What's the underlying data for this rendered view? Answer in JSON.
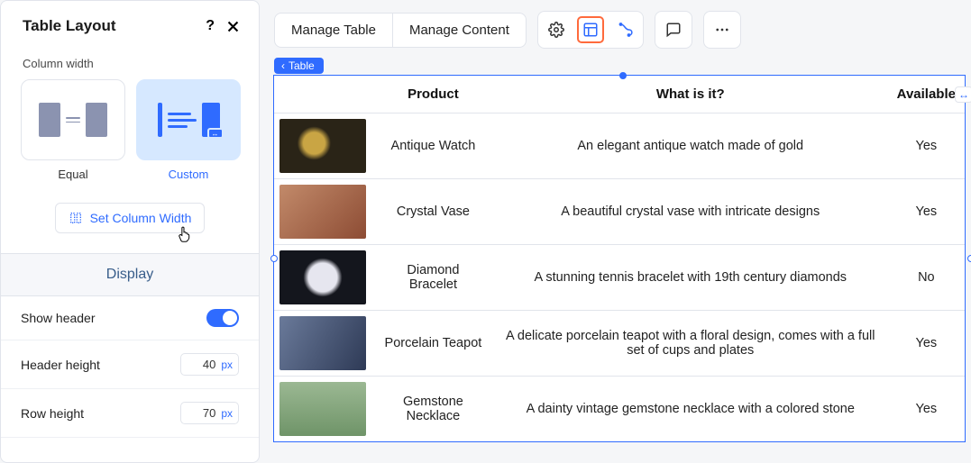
{
  "sidebar": {
    "title": "Table Layout",
    "column_width_label": "Column width",
    "options": {
      "equal": "Equal",
      "custom": "Custom"
    },
    "set_column_width": "Set Column Width",
    "display_label": "Display",
    "show_header_label": "Show header",
    "header_height_label": "Header height",
    "header_height_value": "40",
    "row_height_label": "Row height",
    "row_height_value": "70",
    "unit": "px"
  },
  "toolbar": {
    "manage_table": "Manage Table",
    "manage_content": "Manage Content"
  },
  "breadcrumb": "Table",
  "table": {
    "headers": {
      "product": "Product",
      "what": "What is it?",
      "available": "Available"
    },
    "rows": [
      {
        "product": "Antique Watch",
        "what": "An elegant antique watch made of gold",
        "available": "Yes",
        "thumb": "watch"
      },
      {
        "product": "Crystal Vase",
        "what": "A beautiful crystal vase with intricate designs",
        "available": "Yes",
        "thumb": "vase"
      },
      {
        "product": "Diamond Bracelet",
        "what": "A stunning tennis bracelet with 19th century diamonds",
        "available": "No",
        "thumb": "bracelet"
      },
      {
        "product": "Porcelain Teapot",
        "what": "A delicate porcelain teapot with a floral design, comes with a full set of cups and plates",
        "available": "Yes",
        "thumb": "teapot"
      },
      {
        "product": "Gemstone Necklace",
        "what": "A dainty vintage gemstone necklace with a colored stone",
        "available": "Yes",
        "thumb": "necklace"
      }
    ]
  }
}
